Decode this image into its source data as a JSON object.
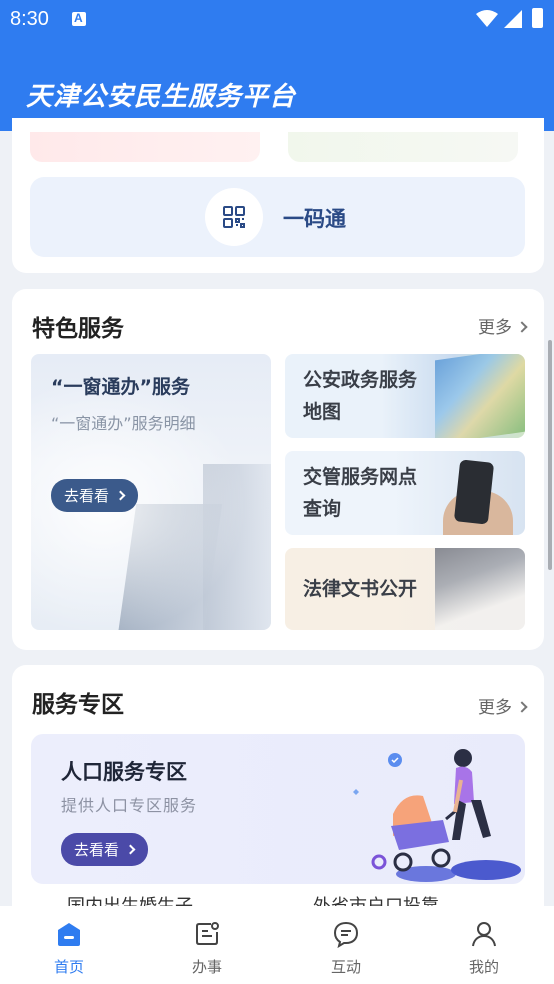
{
  "status_bar": {
    "time": "8:30"
  },
  "header": {
    "title": "天津公安民生服务平台"
  },
  "quick": {
    "label": "一码通"
  },
  "featured": {
    "title": "特色服务",
    "more": "更多",
    "big": {
      "title": "“一窗通办”服务",
      "subtitle": "“一窗通办”服务明细",
      "button": "去看看"
    },
    "small": [
      {
        "line1": "公安政务服务",
        "line2": "地图"
      },
      {
        "line1": "交管服务网点",
        "line2": "查询"
      },
      {
        "line1": "法律文书公开",
        "line2": ""
      }
    ]
  },
  "zone": {
    "title": "服务专区",
    "more": "更多",
    "banner": {
      "title": "人口服务专区",
      "subtitle": "提供人口专区服务",
      "button": "去看看"
    },
    "links": [
      "国内出生婚生子",
      "外省市户口投靠"
    ]
  },
  "nav": [
    {
      "label": "首页",
      "active": true
    },
    {
      "label": "办事",
      "active": false
    },
    {
      "label": "互动",
      "active": false
    },
    {
      "label": "我的",
      "active": false
    }
  ],
  "colors": {
    "primary": "#2f7cf0",
    "navy": "#3b5a8b",
    "purple": "#4b4aa8"
  }
}
